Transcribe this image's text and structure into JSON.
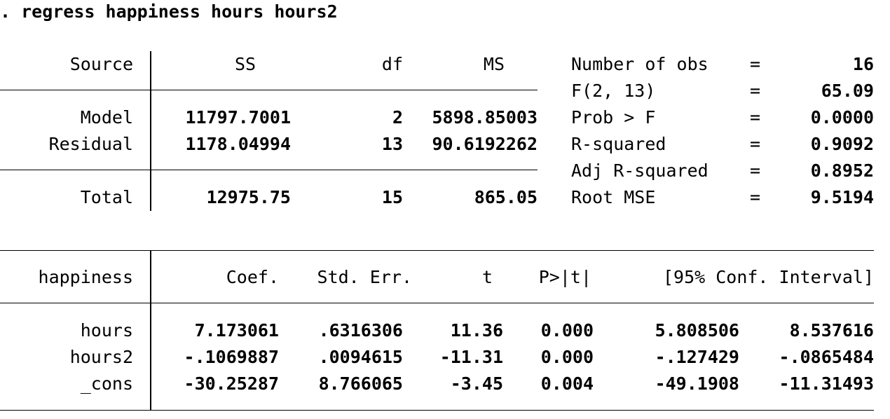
{
  "command": ". regress happiness hours hours2",
  "anova": {
    "headers": {
      "source": "Source",
      "ss": "SS",
      "df": "df",
      "ms": "MS"
    },
    "rows": [
      {
        "source": "Model",
        "ss": "11797.7001",
        "df": "2",
        "ms": "5898.85003"
      },
      {
        "source": "Residual",
        "ss": "1178.04994",
        "df": "13",
        "ms": "90.6192262"
      }
    ],
    "total": {
      "source": "Total",
      "ss": "12975.75",
      "df": "15",
      "ms": "865.05"
    }
  },
  "stats": [
    {
      "label": "Number of obs",
      "eq": "=",
      "value": "16"
    },
    {
      "label": "F(2, 13)",
      "eq": "=",
      "value": "65.09"
    },
    {
      "label": "Prob > F",
      "eq": "=",
      "value": "0.0000"
    },
    {
      "label": "R-squared",
      "eq": "=",
      "value": "0.9092"
    },
    {
      "label": "Adj R-squared",
      "eq": "=",
      "value": "0.8952"
    },
    {
      "label": "Root MSE",
      "eq": "=",
      "value": "9.5194"
    }
  ],
  "coef": {
    "headers": {
      "var": "happiness",
      "coef": "Coef.",
      "se": "Std. Err.",
      "t": "t",
      "p": "P>|t|",
      "ci": "[95% Conf. Interval]"
    },
    "rows": [
      {
        "var": "hours",
        "coef": "7.173061",
        "se": ".6316306",
        "t": "11.36",
        "p": "0.000",
        "lo": "5.808506",
        "hi": "8.537616"
      },
      {
        "var": "hours2",
        "coef": "-.1069887",
        "se": ".0094615",
        "t": "-11.31",
        "p": "0.000",
        "lo": "-.127429",
        "hi": "-.0865484"
      },
      {
        "var": "_cons",
        "coef": "-30.25287",
        "se": "8.766065",
        "t": "-3.45",
        "p": "0.004",
        "lo": "-49.1908",
        "hi": "-11.31493"
      }
    ]
  }
}
